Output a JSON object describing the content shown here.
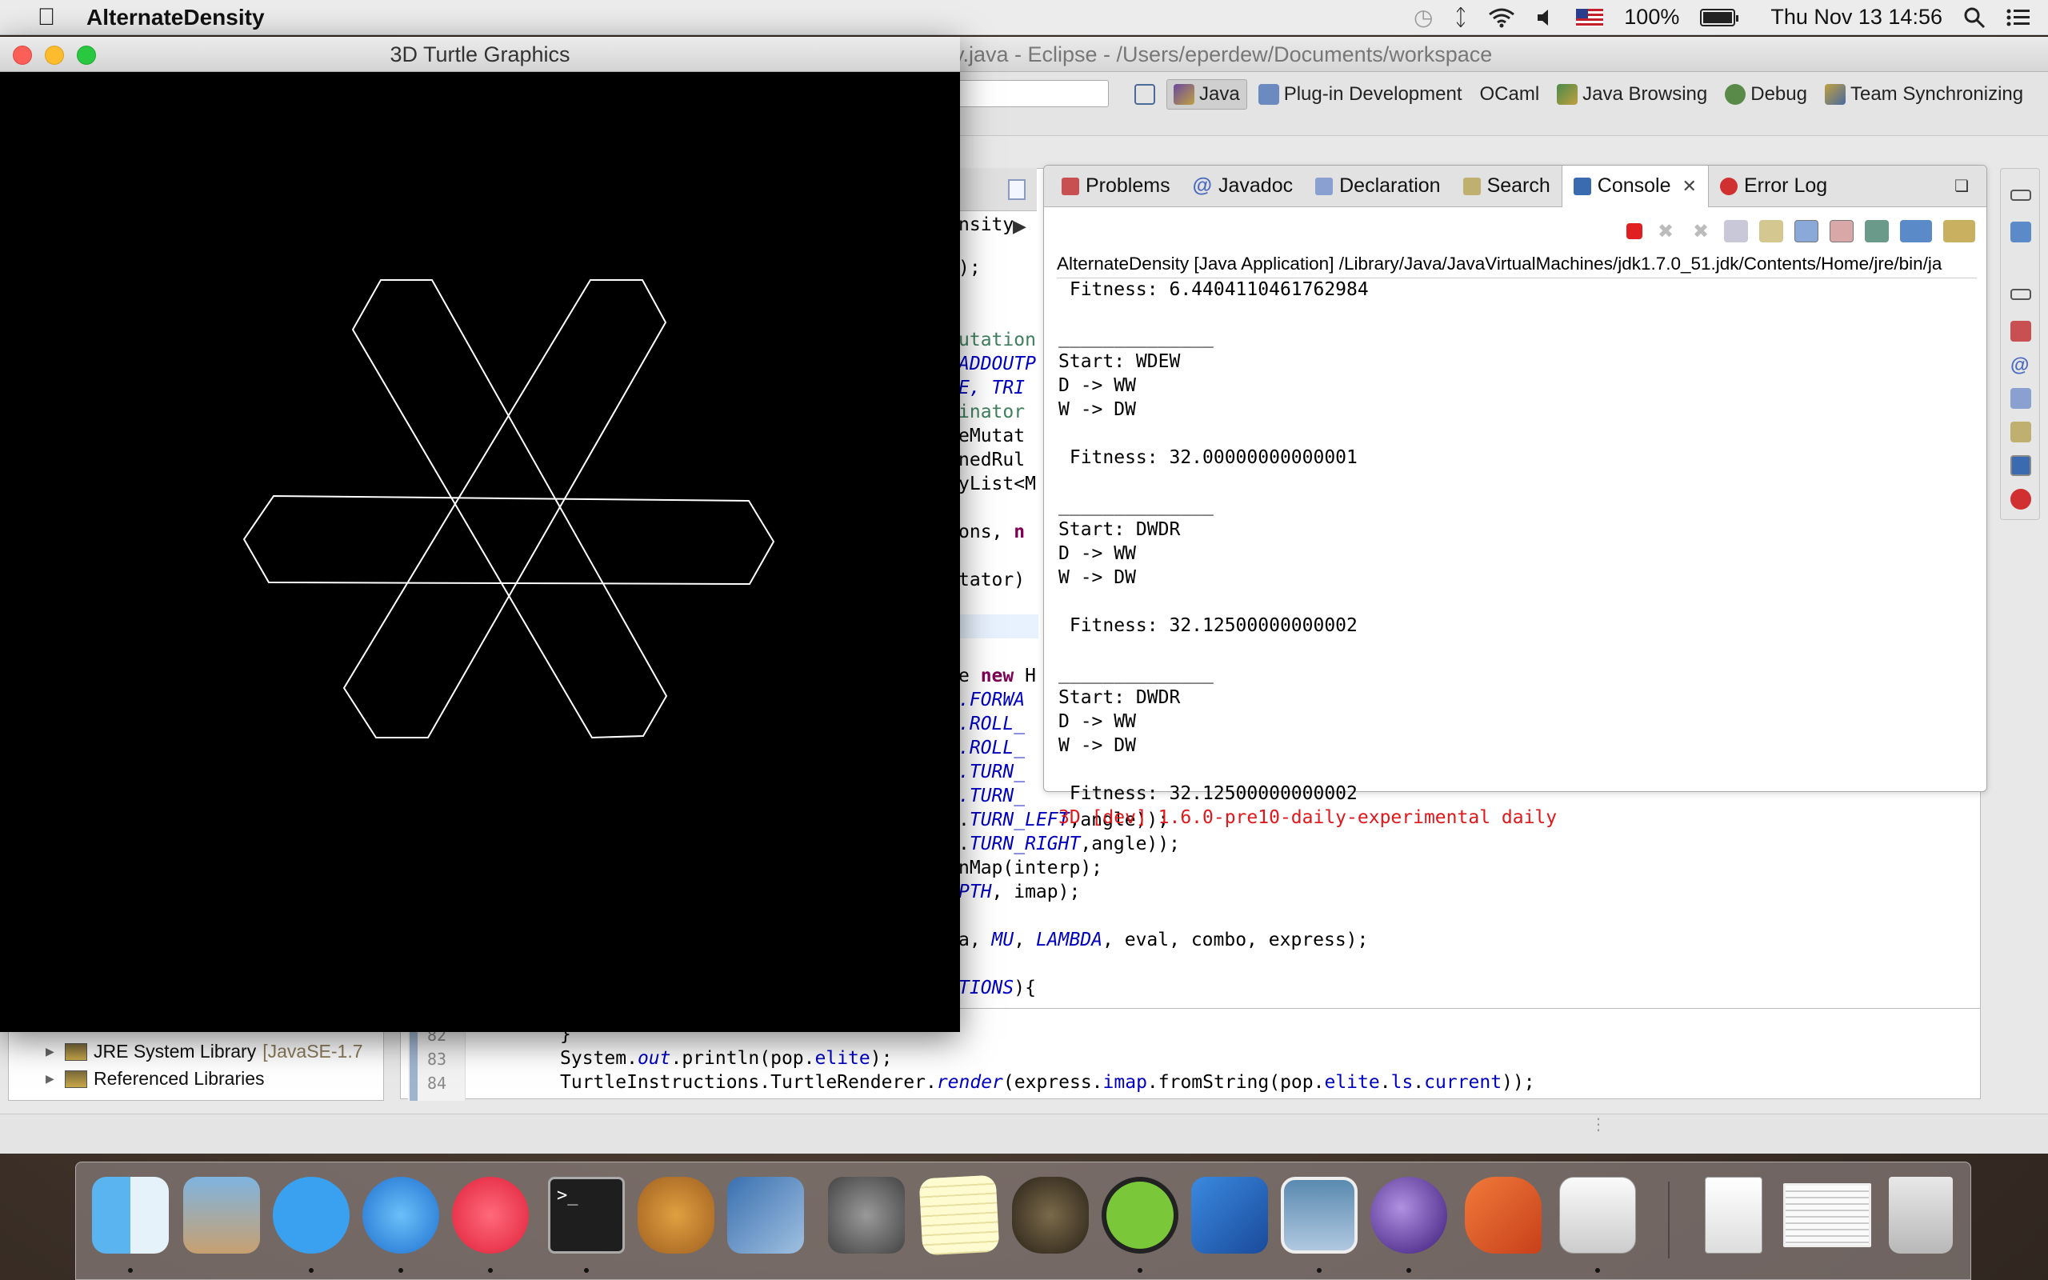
{
  "menubar": {
    "app_name": "AlternateDensity",
    "battery": "100%",
    "clock": "Thu Nov 13  14:56"
  },
  "eclipse": {
    "title": "y.java - Eclipse - /Users/eperdew/Documents/workspace",
    "perspectives": [
      "Java",
      "Plug-in Development",
      "OCaml",
      "Java Browsing",
      "Debug",
      "Team Synchronizing"
    ],
    "active_perspective": "Java",
    "package_explorer": {
      "items": [
        {
          "label": "JRE System Library",
          "suffix": "[JavaSE-1.7"
        },
        {
          "label": "Referenced Libraries",
          "suffix": ""
        }
      ]
    },
    "editor_snippets": {
      "l1": "nsity",
      "l2": ");",
      "l3": "utation",
      "l4": "ADDOUTP",
      "l5": "E, TRI",
      "l6": "inator",
      "l7": "eMutat",
      "l8": "nedRul",
      "l9": "yList<M",
      "l10": "ons, ",
      "l10b": "n",
      "l11": "tator)",
      "l12a": "e ",
      "l12b": "new ",
      "l12c": "H",
      "l13": ".FORWA",
      "l14": ".ROLL_",
      "l15": ".ROLL_",
      "l16": ".TURN_",
      "l17": ".TURN_",
      "l18a": ".",
      "l18b": "TURN_LEFT",
      "l18c": ",angle));",
      "l19a": ".",
      "l19b": "TURN_RIGHT",
      "l19c": ",angle));",
      "l20": "nMap(interp);",
      "l21a": "PTH",
      "l21b": ", imap);",
      "l22a": "a, ",
      "l22b": "MU",
      "l22c": ", ",
      "l22d": "LAMBDA",
      "l22e": ", eval, combo, express);",
      "l23a": "TIONS",
      "l23b": "){",
      "ln82": "82",
      "ln83": "83",
      "ln84": "84",
      "c82": "}",
      "c83a": "System.",
      "c83b": "out",
      "c83c": ".println(pop.",
      "c83d": "elite",
      "c83e": ");",
      "c84a": "TurtleInstructions.TurtleRenderer.",
      "c84b": "render",
      "c84c": "(express.",
      "c84d": "imap",
      "c84e": ".fromString(pop.",
      "c84f": "elite",
      "c84g": ".",
      "c84h": "ls",
      "c84i": ".",
      "c84j": "current",
      "c84k": "));"
    }
  },
  "console": {
    "tabs": [
      "Problems",
      "Javadoc",
      "Declaration",
      "Search",
      "Console",
      "Error Log"
    ],
    "active_tab": "Console",
    "description": "AlternateDensity [Java Application] /Library/Java/JavaVirtualMachines/jdk1.7.0_51.jdk/Contents/Home/jre/bin/ja",
    "output": " Fitness: 6.4404110461762984\n\n______________\nStart: WDEW\nD -> WW\nW -> DW\n\n Fitness: 32.00000000000001\n\n______________\nStart: DWDR\nD -> WW\nW -> DW\n\n Fitness: 32.12500000000002\n\n______________\nStart: DWDR\nD -> WW\nW -> DW\n\n Fitness: 32.12500000000002",
    "error_line": "3D [dev] 1.6.0-pre10-daily-experimental daily"
  },
  "turtle_window": {
    "title": "3D Turtle Graphics"
  },
  "dock": {
    "apps": [
      "finder-icon",
      "mail-icon",
      "messages-icon",
      "safari-icon",
      "itunes-icon",
      "terminal-icon",
      "gnu-icon",
      "virtualbox-icon",
      "system-preferences-icon",
      "notes-icon",
      "cauldron-icon",
      "spotify-icon",
      "xcode-icon",
      "preview-icon",
      "eclipse-icon",
      "powerpoint-icon",
      "java-icon",
      "zip-icon",
      "screenshot-icon",
      "trash-icon"
    ]
  }
}
